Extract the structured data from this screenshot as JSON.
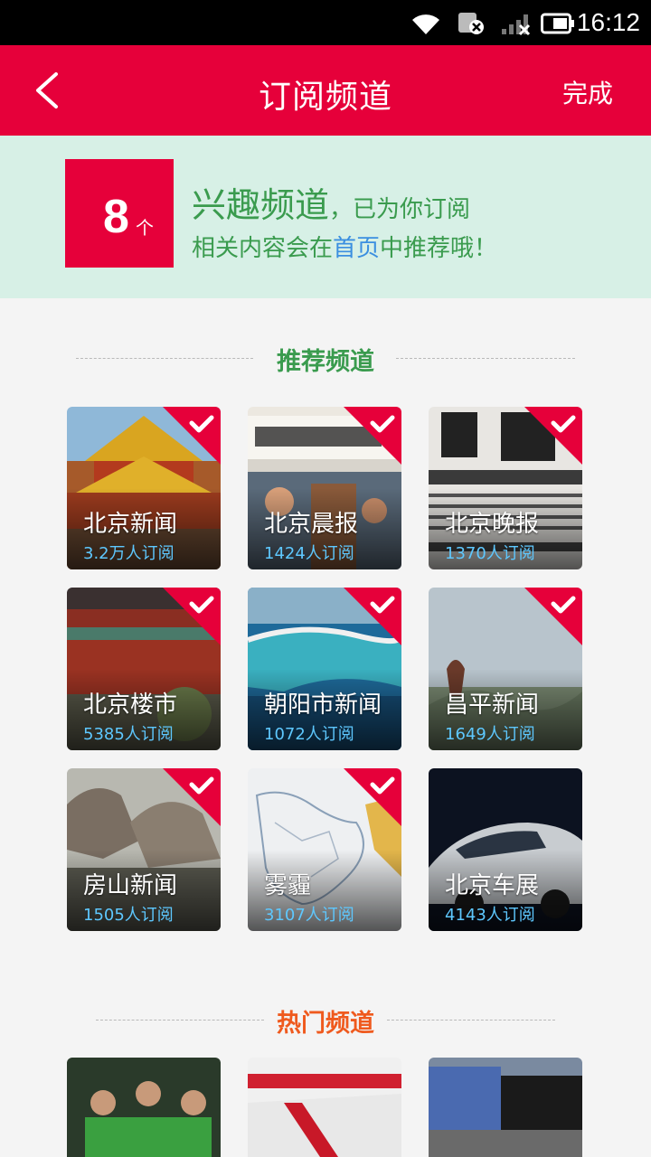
{
  "status_bar": {
    "time": "16:12"
  },
  "nav": {
    "title": "订阅频道",
    "done_label": "完成"
  },
  "banner": {
    "count": "8",
    "count_unit": "个",
    "title": "兴趣频道",
    "title_suffix": "，已为你订阅",
    "line2_a": "相关内容会在",
    "line2_highlight": "首页",
    "line2_b": "中推荐哦！"
  },
  "recommended": {
    "header": "推荐频道",
    "channels": [
      {
        "name": "北京新闻",
        "subs": "3.2万人订阅"
      },
      {
        "name": "北京晨报",
        "subs": "1424人订阅"
      },
      {
        "name": "北京晚报",
        "subs": "1370人订阅"
      },
      {
        "name": "北京楼市",
        "subs": "5385人订阅"
      },
      {
        "name": "朝阳市新闻",
        "subs": "1072人订阅"
      },
      {
        "name": "昌平新闻",
        "subs": "1649人订阅"
      },
      {
        "name": "房山新闻",
        "subs": "1505人订阅"
      },
      {
        "name": "雾霾",
        "subs": "3107人订阅"
      },
      {
        "name": "北京车展",
        "subs": "4143人订阅"
      }
    ]
  },
  "hot": {
    "header": "热门频道"
  },
  "colors": {
    "brand_red": "#e6003a",
    "green": "#3a9b4e",
    "blue_link": "#3b8fe0",
    "orange": "#ef5a1e",
    "subs_blue": "#5ec8ff"
  }
}
